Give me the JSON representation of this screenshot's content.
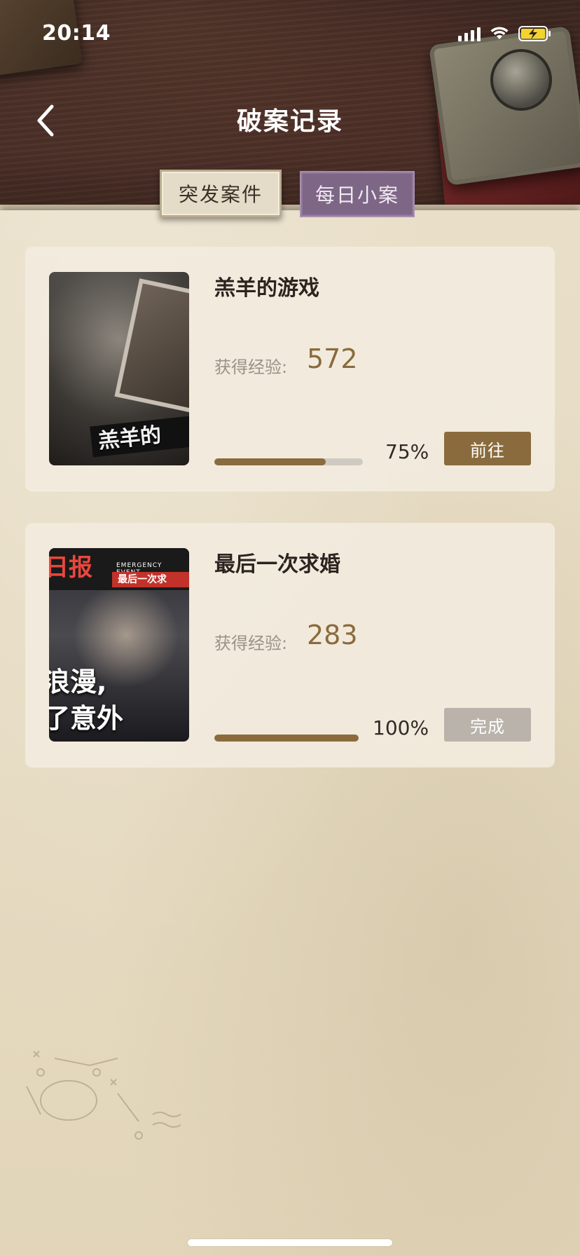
{
  "status_bar": {
    "time": "20:14",
    "icons": [
      "signal-icon",
      "wifi-icon",
      "battery-charging-icon"
    ]
  },
  "header": {
    "title": "破案记录",
    "back_icon": "chevron-left-icon"
  },
  "tabs": [
    {
      "label": "突发案件",
      "active": true
    },
    {
      "label": "每日小案",
      "active": false
    }
  ],
  "cases": [
    {
      "title": "羔羊的游戏",
      "exp_label": "获得经验:",
      "exp_value": "572",
      "progress": 0.75,
      "progress_text": "75%",
      "button_label": "前往",
      "thumbnail_text": "羔羊的"
    },
    {
      "title": "最后一次求婚",
      "exp_label": "获得经验:",
      "exp_value": "283",
      "progress": 1.0,
      "progress_text": "100%",
      "button_label": "完成",
      "thumbnail_text": {
        "header": "日报",
        "sub": "EMERGENCY EVENT",
        "title": "最后一次求",
        "line1": "浪漫,",
        "line2": "了意外"
      }
    }
  ],
  "colors": {
    "accent": "#8a6b3d",
    "done_button": "#b9b3ab",
    "active_tab": "#e4dcc8",
    "inactive_tab": "#7d6686"
  }
}
